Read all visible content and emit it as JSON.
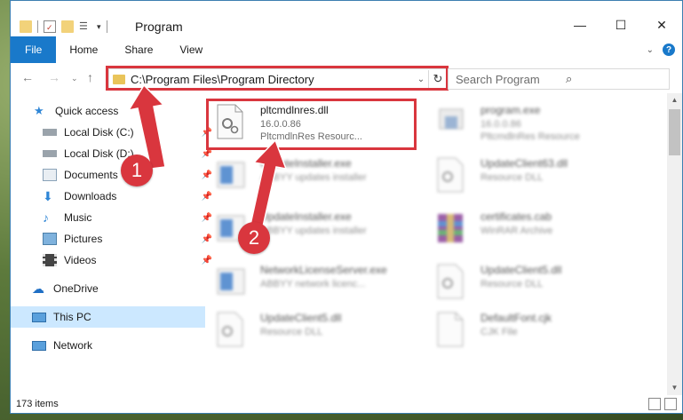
{
  "window": {
    "title": "Program"
  },
  "ribbon": {
    "tabs": [
      "File",
      "Home",
      "Share",
      "View"
    ]
  },
  "address": {
    "path": "C:\\Program Files\\Program Directory"
  },
  "search": {
    "placeholder": "Search Program"
  },
  "sidebar": {
    "items": [
      {
        "label": "Quick access",
        "icon": "star-icon"
      },
      {
        "label": "Local Disk (C:)",
        "icon": "drive-icon"
      },
      {
        "label": "Local Disk (D:)",
        "icon": "drive-icon"
      },
      {
        "label": "Documents",
        "icon": "documents-icon"
      },
      {
        "label": "Downloads",
        "icon": "download-icon"
      },
      {
        "label": "Music",
        "icon": "music-icon"
      },
      {
        "label": "Pictures",
        "icon": "pictures-icon"
      },
      {
        "label": "Videos",
        "icon": "videos-icon"
      },
      {
        "label": "OneDrive",
        "icon": "cloud-icon"
      },
      {
        "label": "This PC",
        "icon": "pc-icon"
      },
      {
        "label": "Network",
        "icon": "network-icon"
      }
    ]
  },
  "files": [
    {
      "name": "pltcmdlnres.dll",
      "line2": "16.0.0.86",
      "line3": "PltcmdlnRes Resourc...",
      "kind": "dll"
    },
    {
      "name": "program.exe",
      "line2": "16.0.0.86",
      "line3": "PltcmdlnRes Resource",
      "kind": "exe"
    },
    {
      "name": "UpdateInstaller.exe",
      "line2": "ABBYY updates installer",
      "line3": "",
      "kind": "installer"
    },
    {
      "name": "UpdateClient63.dll",
      "line2": "Resource DLL",
      "line3": "",
      "kind": "dll"
    },
    {
      "name": "UpdateInstaller.exe",
      "line2": "ABBYY updates installer",
      "line3": "",
      "kind": "installer"
    },
    {
      "name": "certificates.cab",
      "line2": "WinRAR Archive",
      "line3": "",
      "kind": "archive"
    },
    {
      "name": "NetworkLicenseServer.exe",
      "line2": "ABBYY network licenc...",
      "line3": "",
      "kind": "installer"
    },
    {
      "name": "UpdateClient5.dll",
      "line2": "Resource DLL",
      "line3": "",
      "kind": "dll"
    },
    {
      "name": "UpdateClient5.dll",
      "line2": "Resource DLL",
      "line3": "",
      "kind": "dll"
    },
    {
      "name": "DefaultFont.cjk",
      "line2": "CJK File",
      "line3": "",
      "kind": "file"
    }
  ],
  "status": {
    "count": "173 items"
  },
  "annotations": {
    "step1": "1",
    "step2": "2",
    "color": "#d9363e"
  }
}
